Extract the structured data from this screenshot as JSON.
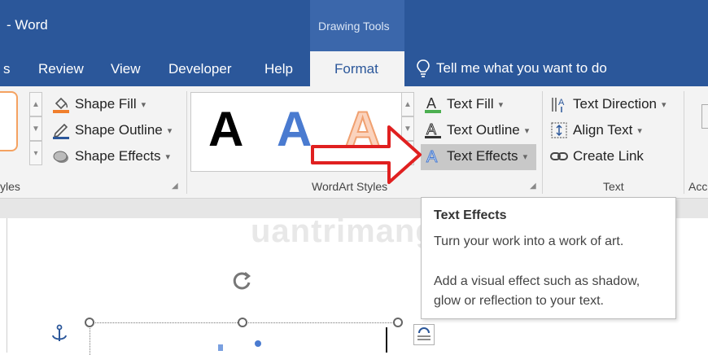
{
  "window": {
    "title": "- Word",
    "context_group": "Drawing Tools"
  },
  "tabs": [
    {
      "label": "s"
    },
    {
      "label": "Review"
    },
    {
      "label": "View"
    },
    {
      "label": "Developer"
    },
    {
      "label": "Help"
    },
    {
      "label": "Format",
      "active": true
    }
  ],
  "tell_me": {
    "label": "Tell me what you want to do"
  },
  "ribbon": {
    "shape_styles": {
      "label": "yles",
      "shape_fill": "Shape Fill",
      "shape_outline": "Shape Outline",
      "shape_effects": "Shape Effects"
    },
    "wordart_styles": {
      "label": "WordArt Styles",
      "samples": [
        "A",
        "A",
        "A"
      ],
      "text_fill": "Text Fill",
      "text_outline": "Text Outline",
      "text_effects": "Text Effects"
    },
    "text": {
      "label": "Text",
      "text_direction": "Text Direction",
      "align_text": "Align Text",
      "create_link": "Create Link"
    },
    "next_group": {
      "label": "Acc"
    }
  },
  "tooltip": {
    "title": "Text Effects",
    "line1": "Turn your work into a work of art.",
    "line2": "Add a visual effect such as shadow, glow or reflection to your text."
  },
  "watermark": {
    "text": "uantrimang"
  },
  "colors": {
    "brand": "#2b579a",
    "arrow": "#e02020",
    "shape_fill": "#f07f2c"
  }
}
